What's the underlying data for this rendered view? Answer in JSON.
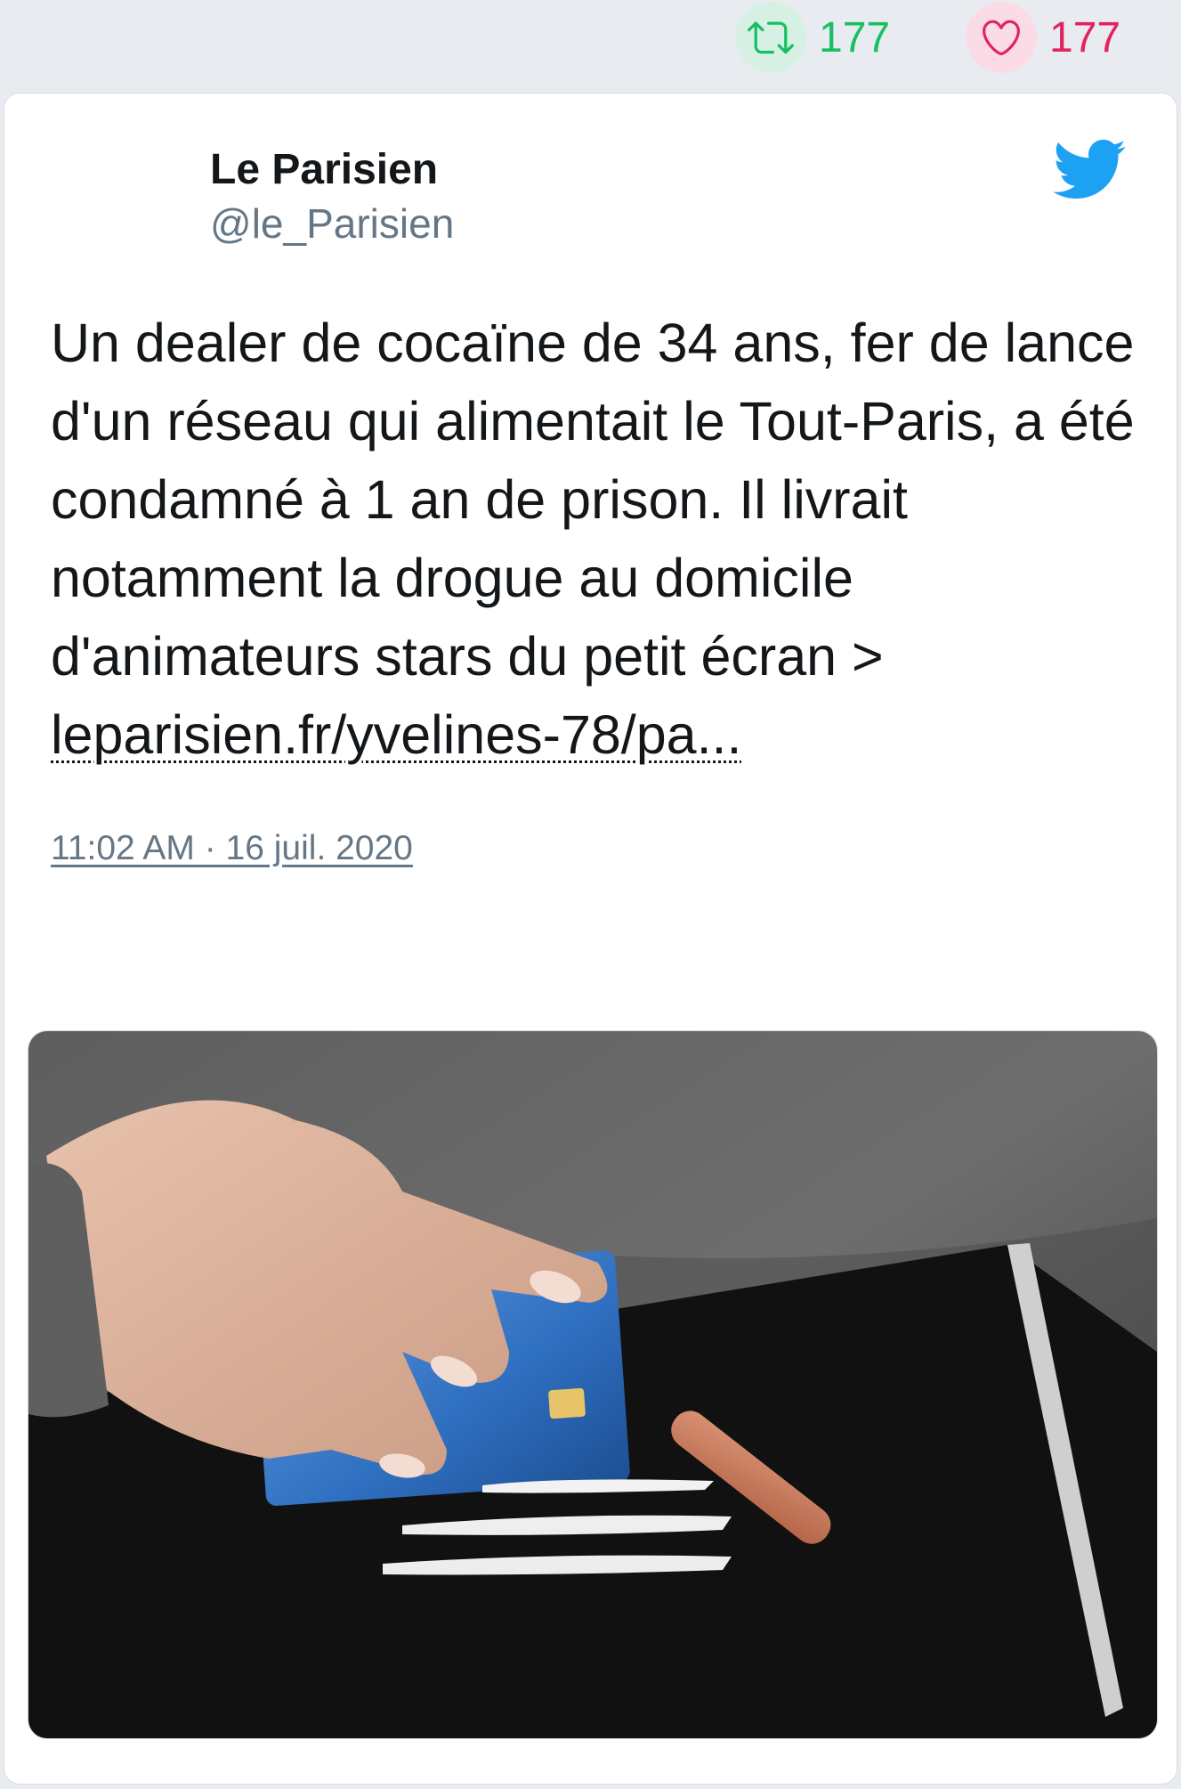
{
  "stats": {
    "retweet_count": "177",
    "like_count": "177",
    "retweet_color": "#17bf63",
    "like_color": "#e0245e"
  },
  "tweet": {
    "author_name": "Le Parisien",
    "author_handle": "@le_Parisien",
    "text": "Un dealer de cocaïne de 34 ans, fer de lance d'un réseau qui alimentait le Tout-Paris, a été condamné à 1 an de prison. Il livrait notamment la drogue au domicile d'animateurs stars du petit écran > ",
    "link_text": "leparisien.fr/yvelines-78/pa...",
    "timestamp": "11:02 AM · 16 juil. 2020"
  },
  "icons": {
    "top_retweet": "retweet-icon",
    "top_like": "heart-icon",
    "brand": "twitter-bird-icon",
    "reply": "reply-icon",
    "retweet": "retweet-icon",
    "like": "heart-icon"
  },
  "media": {
    "description_icon": "photo"
  }
}
